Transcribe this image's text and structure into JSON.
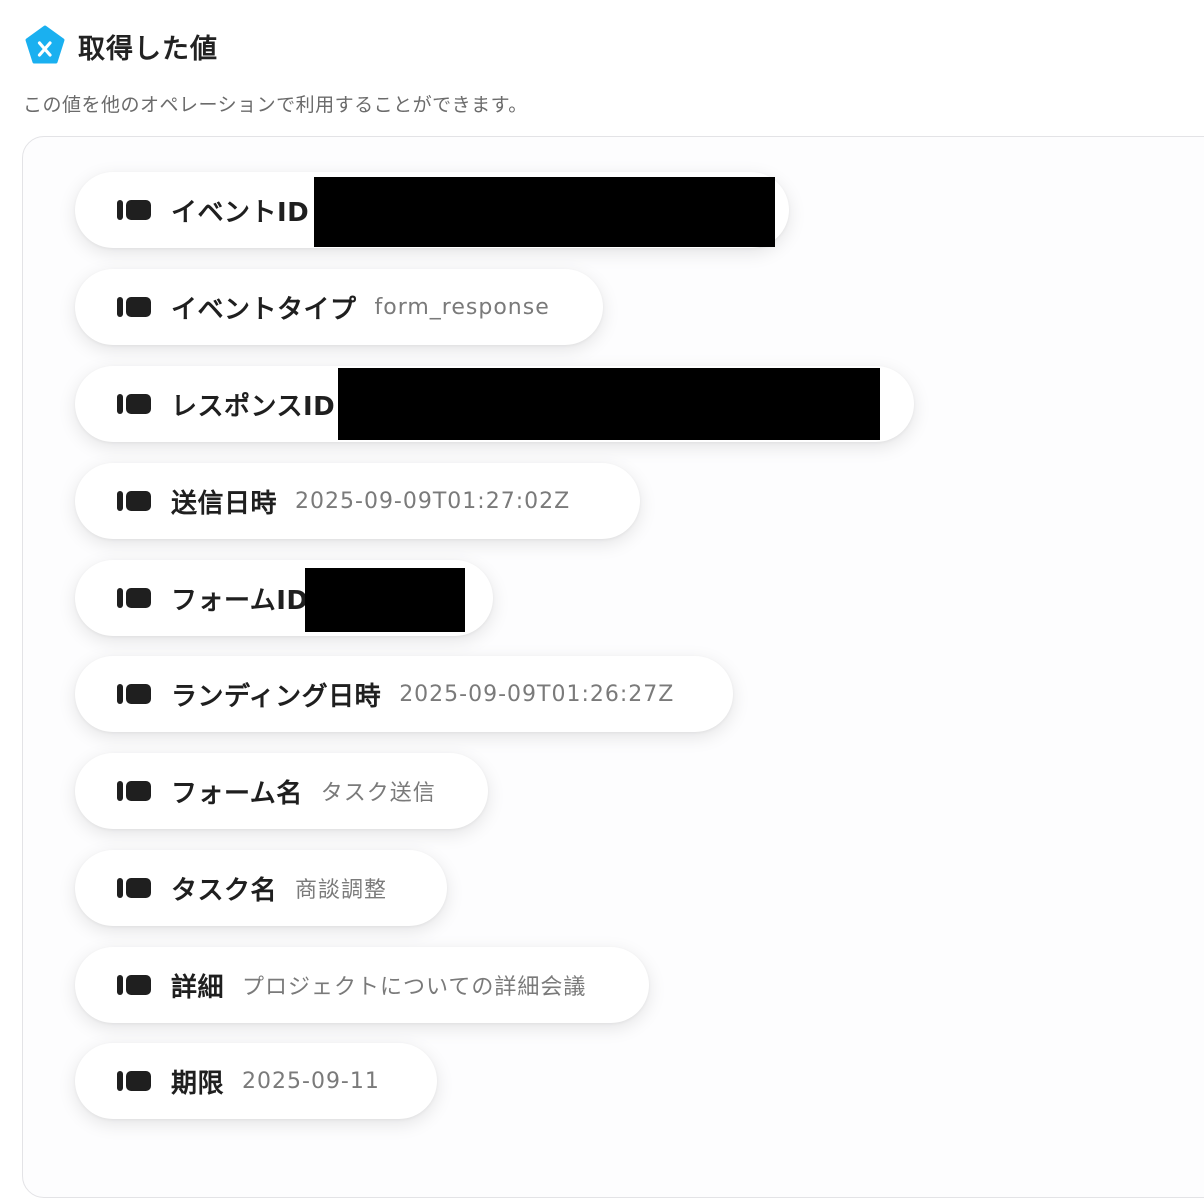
{
  "header": {
    "title": "取得した値",
    "description": "この値を他のオペレーションで利用することができます。",
    "icon": "yoom-logo-icon",
    "accent_color": "#1ab0f0"
  },
  "items": [
    {
      "label": "イベントID",
      "value": "",
      "redacted": true
    },
    {
      "label": "イベントタイプ",
      "value": "form_response",
      "redacted": false
    },
    {
      "label": "レスポンスID",
      "value": "",
      "redacted": true
    },
    {
      "label": "送信日時",
      "value": "2025-09-09T01:27:02Z",
      "redacted": false
    },
    {
      "label": "フォームID",
      "value": "",
      "redacted": true
    },
    {
      "label": "ランディング日時",
      "value": "2025-09-09T01:26:27Z",
      "redacted": false
    },
    {
      "label": "フォーム名",
      "value": "タスク送信",
      "redacted": false
    },
    {
      "label": "タスク名",
      "value": "商談調整",
      "redacted": false
    },
    {
      "label": "詳細",
      "value": "プロジェクトについての詳細会議",
      "redacted": false
    },
    {
      "label": "期限",
      "value": "2025-09-11",
      "redacted": false
    }
  ]
}
